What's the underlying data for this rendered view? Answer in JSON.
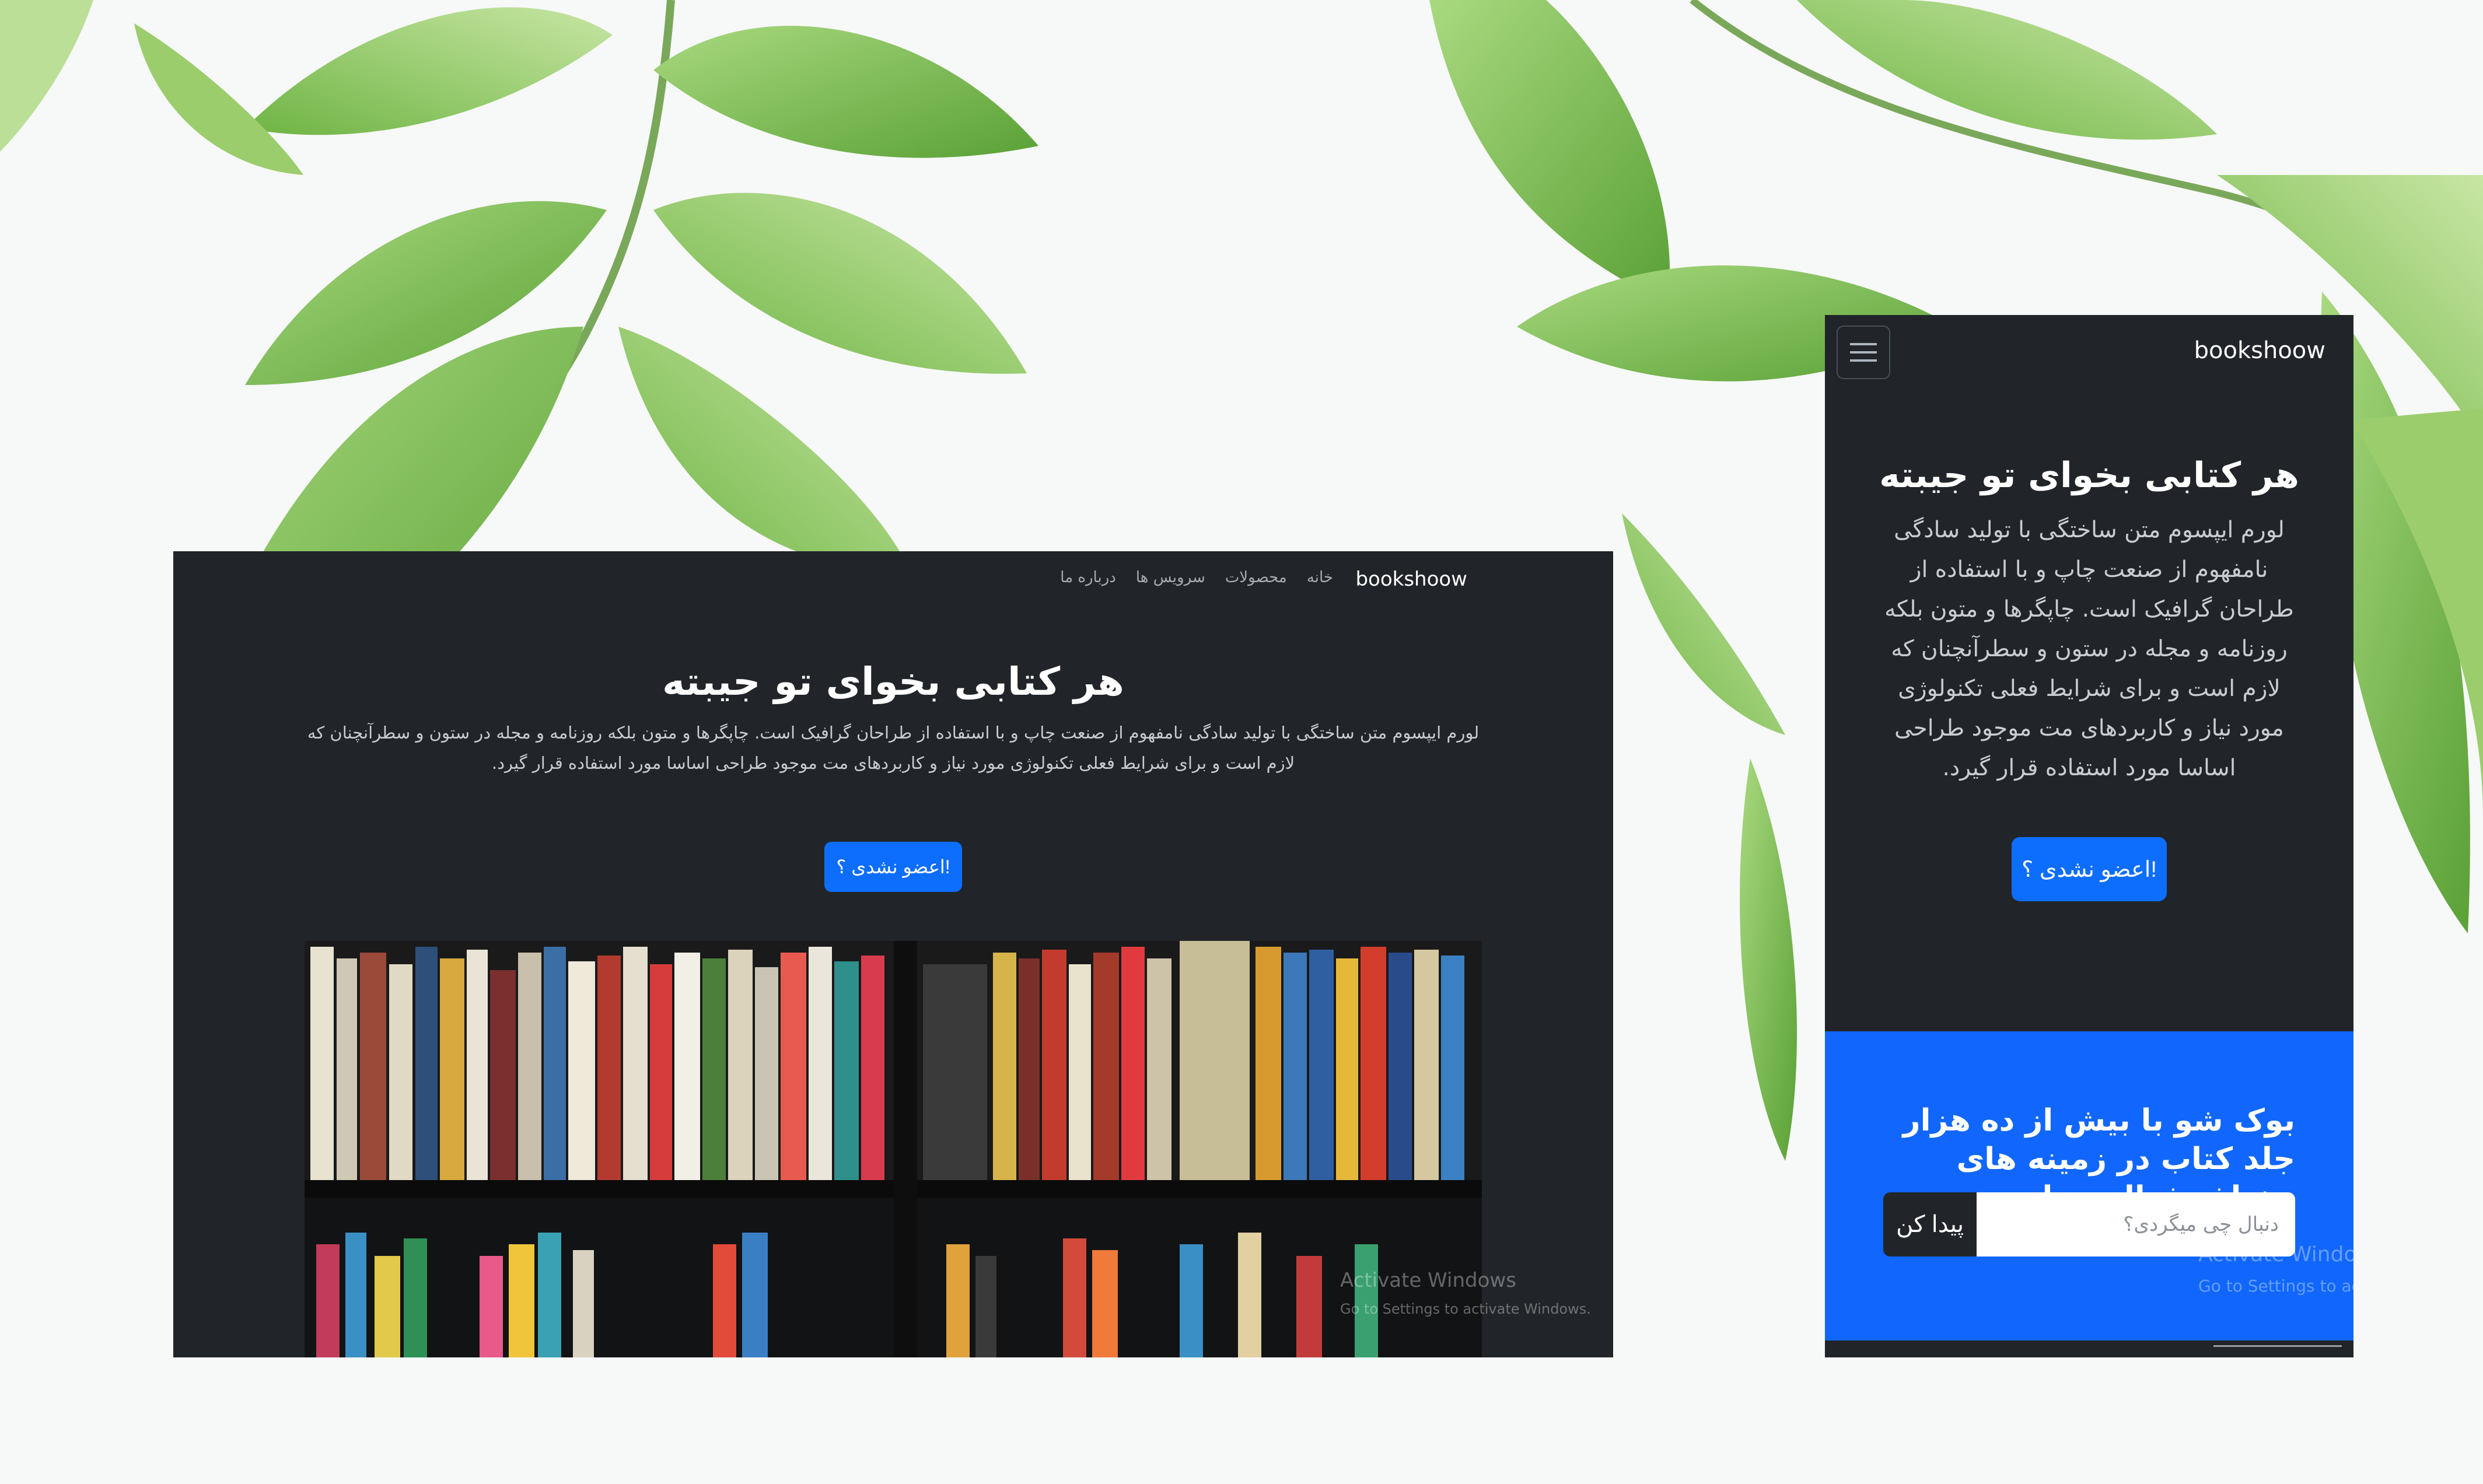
{
  "desktop": {
    "brand": "bookshoow",
    "nav": [
      "خانه",
      "محصولات",
      "سرویس ها",
      "درباره ما"
    ],
    "hero_title": "هر کتابی بخوای تو جیبته",
    "hero_text": "لورم ایپسوم متن ساختگی با تولید سادگی نامفهوم از صنعت چاپ و با استفاده از طراحان گرافیک است. چاپگرها و متون بلکه روزنامه و مجله در ستون و سطرآنچنان که لازم است و برای شرایط فعلی تکنولوژی مورد نیاز و کاربردهای مت موجود طراحی اساسا مورد استفاده قرار گیرد.",
    "cta_label": "!اعضو نشدی ؟",
    "watermark_title": "Activate Windows",
    "watermark_sub": "Go to Settings to activate Windows."
  },
  "mobile": {
    "brand": "bookshoow",
    "menu_icon": "hamburger-icon",
    "hero_title": "هر کتابی بخوای تو جیبته",
    "hero_text": "لورم ایپسوم متن ساختگی با تولید سادگی نامفهوم از صنعت چاپ و با استفاده از طراحان گرافیک است. چاپگرها و متون بلکه روزنامه و مجله در ستون و سطرآنچنان که لازم است و برای شرایط فعلی تکنولوژی مورد نیاز و کاربردهای مت موجود طراحی اساسا مورد استفاده قرار گیرد.",
    "cta_label": "!اعضو نشدی ؟",
    "promo_title": "بوک شو با بیش از ده هزار جلد کتاب در زمینه های مختلف فعالیت داره...",
    "search_placeholder": "دنبال چی میگردی؟",
    "search_button": "پیدا کن",
    "watermark_title": "Activate Windows",
    "watermark_sub": "Go to Settings to activate Windows."
  },
  "colors": {
    "dark_bg": "#212529",
    "primary": "#0d6efd",
    "leaf": "#7fc24f"
  }
}
